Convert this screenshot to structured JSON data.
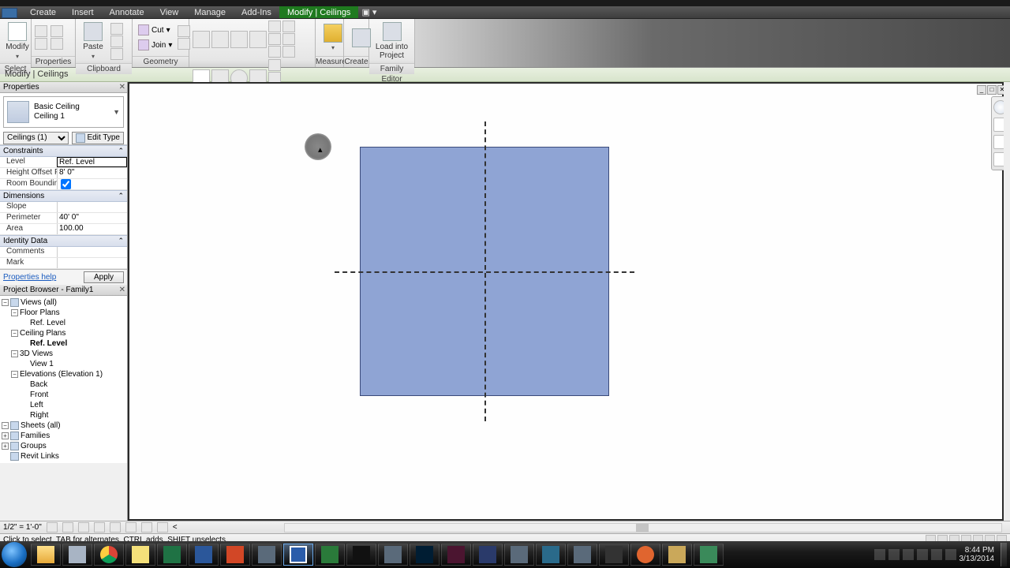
{
  "ribbon": {
    "tabs": [
      "Create",
      "Insert",
      "Annotate",
      "View",
      "Manage",
      "Add-Ins",
      "Modify | Ceilings"
    ],
    "active_tab_index": 6,
    "panels": {
      "select": "Select",
      "properties": "Properties",
      "clipboard": "Clipboard",
      "geometry": "Geometry",
      "modify": "Modify",
      "measure": "Measure",
      "create": "Create",
      "family_editor": "Family Editor"
    },
    "buttons": {
      "modify": "Modify",
      "paste": "Paste",
      "cut": "Cut",
      "join": "Join",
      "load": "Load into\nProject"
    }
  },
  "options_bar": {
    "label": "Modify | Ceilings"
  },
  "properties": {
    "title": "Properties",
    "type_family": "Basic Ceiling",
    "type_name": "Ceiling 1",
    "filter": "Ceilings (1)",
    "edit_type": "Edit Type",
    "groups": {
      "constraints": "Constraints",
      "dimensions": "Dimensions",
      "identity": "Identity Data"
    },
    "rows": {
      "level_k": "Level",
      "level_v": "Ref. Level",
      "hof_k": "Height Offset F...",
      "hof_v": "8'  0\"",
      "rb_k": "Room Bounding",
      "slope_k": "Slope",
      "slope_v": "",
      "perim_k": "Perimeter",
      "perim_v": "40'  0\"",
      "area_k": "Area",
      "area_v": "100.00",
      "comments_k": "Comments",
      "comments_v": "",
      "mark_k": "Mark",
      "mark_v": ""
    },
    "help": "Properties help",
    "apply": "Apply"
  },
  "browser": {
    "title": "Project Browser - Family1",
    "nodes": {
      "views": "Views (all)",
      "floor_plans": "Floor Plans",
      "fp_ref": "Ref. Level",
      "ceiling_plans": "Ceiling Plans",
      "cp_ref": "Ref. Level",
      "tdv": "3D Views",
      "view1": "View 1",
      "elev": "Elevations (Elevation 1)",
      "back": "Back",
      "front": "Front",
      "left": "Left",
      "right": "Right",
      "sheets": "Sheets (all)",
      "families": "Families",
      "groups": "Groups",
      "links": "Revit Links"
    }
  },
  "viewctrl": {
    "scale": "1/2\" = 1'-0\""
  },
  "status": {
    "hint": "Click to select, TAB for alternates, CTRL adds, SHIFT unselects."
  },
  "taskbar": {
    "time": "8:44 PM",
    "date": "3/13/2014"
  }
}
